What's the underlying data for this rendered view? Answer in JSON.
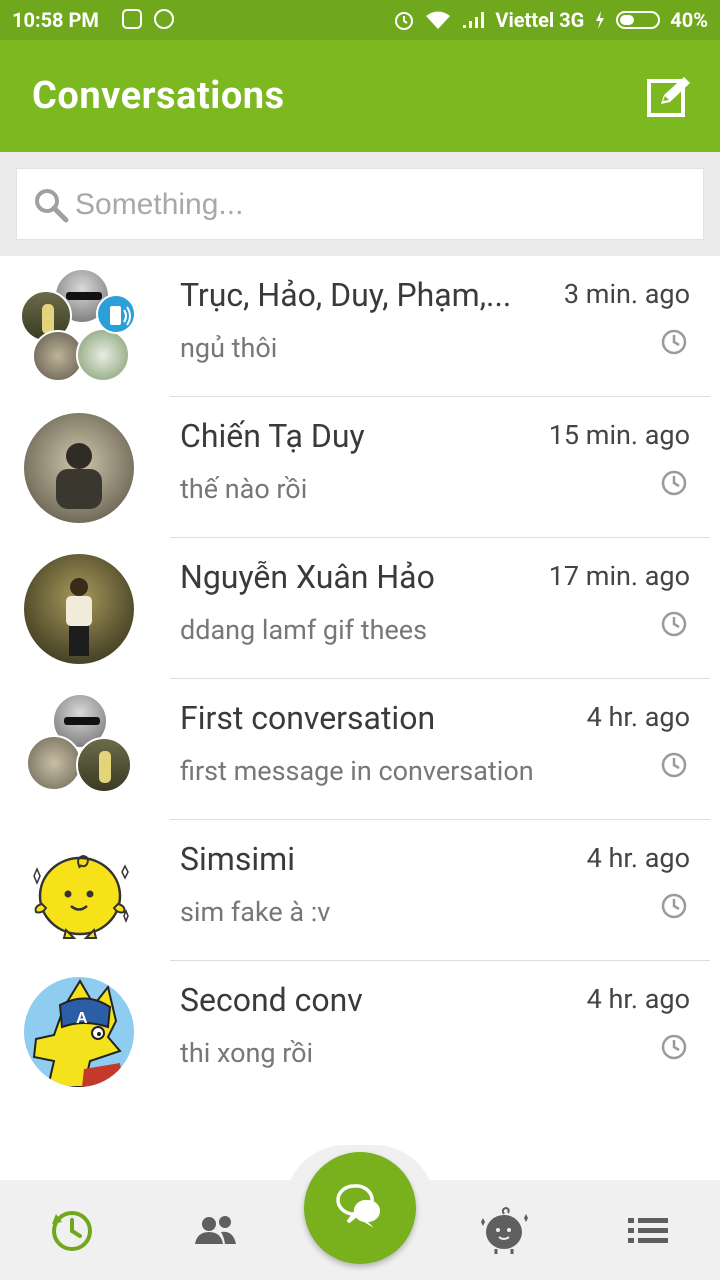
{
  "status_bar": {
    "time": "10:58 PM",
    "carrier": "Viettel 3G",
    "battery": "40%",
    "battery_level": 0.4
  },
  "app_bar": {
    "title": "Conversations",
    "compose_icon": "compose-icon"
  },
  "search": {
    "placeholder": "Something...",
    "value": ""
  },
  "conversations": [
    {
      "name": "Trục, Hảo, Duy, Phạm,...",
      "time": "3 min. ago",
      "message": "ngủ thôi"
    },
    {
      "name": "Chiến Tạ Duy",
      "time": "15 min. ago",
      "message": "thế nào rồi"
    },
    {
      "name": "Nguyễn Xuân Hảo",
      "time": "17 min. ago",
      "message": "ddang lamf gif thees"
    },
    {
      "name": "First conversation",
      "time": "4 hr. ago",
      "message": "first message in conversation"
    },
    {
      "name": "Simsimi",
      "time": "4 hr. ago",
      "message": "sim fake à :v"
    },
    {
      "name": "Second conv",
      "time": "4 hr. ago",
      "message": "thi xong rồi"
    }
  ],
  "bottom_nav": {
    "items": [
      "recent-icon",
      "contacts-icon",
      "chat-fab-icon",
      "simsimi-icon",
      "menu-icon"
    ],
    "active": "recent-icon"
  },
  "colors": {
    "status_bar": "#6fa81c",
    "app_bar": "#7cb920",
    "fab": "#79b01e",
    "accent": "#7cb920"
  }
}
